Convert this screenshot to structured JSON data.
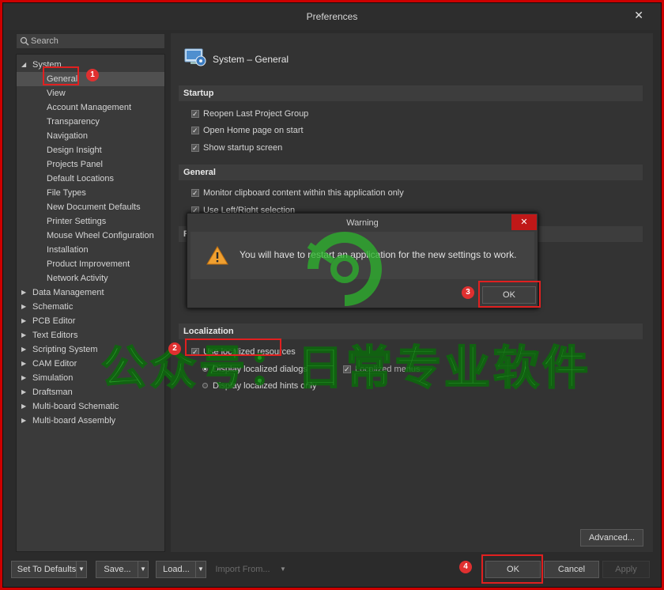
{
  "window": {
    "title": "Preferences",
    "close": "✕"
  },
  "search": {
    "placeholder": "Search"
  },
  "tree": {
    "system": "System",
    "system_children": [
      "General",
      "View",
      "Account Management",
      "Transparency",
      "Navigation",
      "Design Insight",
      "Projects Panel",
      "Default Locations",
      "File Types",
      "New Document Defaults",
      "Printer Settings",
      "Mouse Wheel Configuration",
      "Installation",
      "Product Improvement",
      "Network Activity"
    ],
    "groups": [
      "Data Management",
      "Schematic",
      "PCB Editor",
      "Text Editors",
      "Scripting System",
      "CAM Editor",
      "Simulation",
      "Draftsman",
      "Multi-board Schematic",
      "Multi-board Assembly"
    ],
    "selected": "General"
  },
  "page": {
    "title": "System – General",
    "startup": {
      "heading": "Startup",
      "items": [
        "Reopen Last Project Group",
        "Open Home page on start",
        "Show startup screen"
      ]
    },
    "general": {
      "heading": "General",
      "items": [
        "Monitor clipboard content within this application only",
        "Use Left/Right selection"
      ]
    },
    "hidden_heading": "Re",
    "localization": {
      "heading": "Localization",
      "use_localized": "Use localized resources",
      "dialogs": "Display localized dialogs",
      "menus": "Localized menus",
      "hints": "Display localized hints only"
    },
    "advanced": "Advanced..."
  },
  "footer": {
    "set_defaults": "Set To Defaults",
    "save": "Save...",
    "load": "Load...",
    "import": "Import From...",
    "ok": "OK",
    "cancel": "Cancel",
    "apply": "Apply"
  },
  "warning": {
    "title": "Warning",
    "close": "✕",
    "message": "You will have to restart an application for the new settings to work.",
    "ok": "OK"
  },
  "badges": [
    "1",
    "2",
    "3",
    "4"
  ],
  "watermark": {
    "text": "公众号：日常专业软件"
  }
}
